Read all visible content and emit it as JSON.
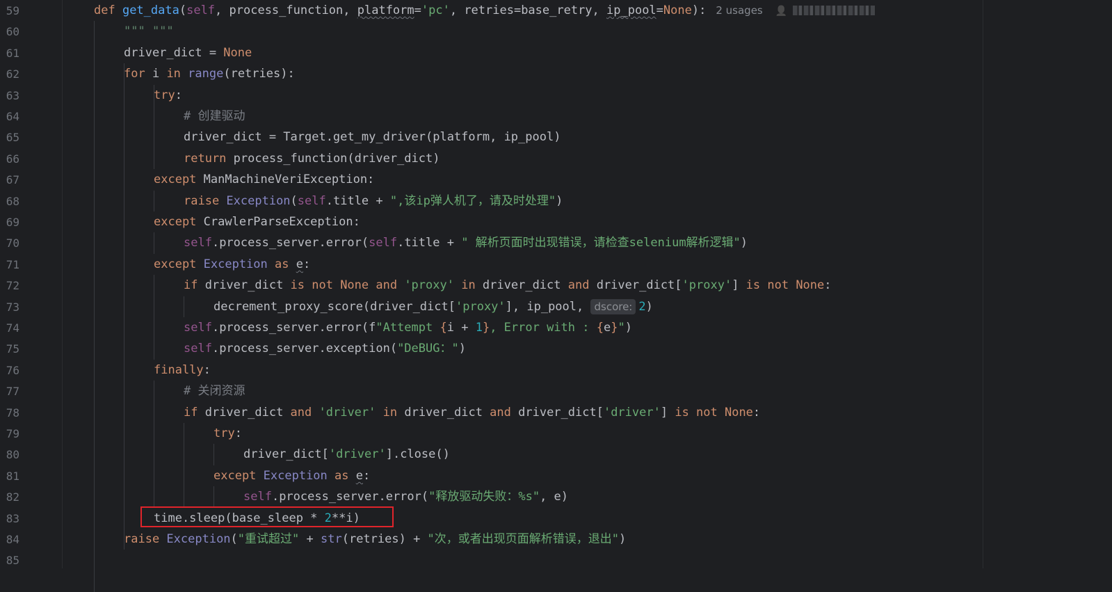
{
  "editor": {
    "lines": [
      {
        "n": "59",
        "t": [
          [
            "kw",
            "def "
          ],
          [
            "fn",
            "get_data"
          ],
          [
            "var",
            "("
          ],
          [
            "selfk",
            "self"
          ],
          [
            "var",
            ", process_function, "
          ],
          [
            "wavy",
            "platform"
          ],
          [
            "var",
            "="
          ],
          [
            "str",
            "'pc'"
          ],
          [
            "var",
            ", retries=base_retry, "
          ],
          [
            "wavy",
            "ip_pool"
          ],
          [
            "var",
            "="
          ],
          [
            "kw",
            "None"
          ],
          [
            "var",
            "):"
          ]
        ]
      },
      {
        "n": "60",
        "t": [
          [
            "doc",
            "\"\"\" \"\"\""
          ]
        ]
      },
      {
        "n": "61",
        "t": [
          [
            "var",
            "driver_dict = "
          ],
          [
            "kw",
            "None"
          ]
        ]
      },
      {
        "n": "62",
        "t": [
          [
            "kw",
            "for "
          ],
          [
            "var",
            "i "
          ],
          [
            "kw",
            "in "
          ],
          [
            "bi",
            "range"
          ],
          [
            "var",
            "(retries):"
          ]
        ]
      },
      {
        "n": "63",
        "t": [
          [
            "kw",
            "try"
          ],
          [
            "var",
            ":"
          ]
        ]
      },
      {
        "n": "64",
        "t": [
          [
            "cm",
            "# 创建驱动"
          ]
        ]
      },
      {
        "n": "65",
        "t": [
          [
            "var",
            "driver_dict = Target.get_my_driver(platform, ip_pool)"
          ]
        ]
      },
      {
        "n": "66",
        "t": [
          [
            "kw",
            "return "
          ],
          [
            "var",
            "process_function(driver_dict)"
          ]
        ]
      },
      {
        "n": "67",
        "t": [
          [
            "kw",
            "except "
          ],
          [
            "var",
            "ManMachineVeriException:"
          ]
        ]
      },
      {
        "n": "68",
        "t": [
          [
            "kw",
            "raise "
          ],
          [
            "bi",
            "Exception"
          ],
          [
            "var",
            "("
          ],
          [
            "selfk",
            "self"
          ],
          [
            "var",
            ".title + "
          ],
          [
            "str",
            "\",该ip弹人机了，请及时处理\""
          ],
          [
            "var",
            ")"
          ]
        ]
      },
      {
        "n": "69",
        "t": [
          [
            "kw",
            "except "
          ],
          [
            "var",
            "CrawlerParseException:"
          ]
        ]
      },
      {
        "n": "70",
        "t": [
          [
            "selfk",
            "self"
          ],
          [
            "var",
            ".process_server.error("
          ],
          [
            "selfk",
            "self"
          ],
          [
            "var",
            ".title + "
          ],
          [
            "str",
            "\" 解析页面时出现错误，请检查selenium解析逻辑\""
          ],
          [
            "var",
            ")"
          ]
        ]
      },
      {
        "n": "71",
        "t": [
          [
            "kw",
            "except "
          ],
          [
            "bi",
            "Exception "
          ],
          [
            "kw",
            "as "
          ],
          [
            "wavy",
            "e"
          ],
          [
            "var",
            ":"
          ]
        ]
      },
      {
        "n": "72",
        "t": [
          [
            "kw",
            "if "
          ],
          [
            "var",
            "driver_dict "
          ],
          [
            "kw",
            "is not None and "
          ],
          [
            "str",
            "'proxy' "
          ],
          [
            "kw",
            "in "
          ],
          [
            "var",
            "driver_dict "
          ],
          [
            "kw",
            "and "
          ],
          [
            "var",
            "driver_dict["
          ],
          [
            "str",
            "'proxy'"
          ],
          [
            "var",
            "] "
          ],
          [
            "kw",
            "is not None"
          ],
          [
            "var",
            ":"
          ]
        ]
      },
      {
        "n": "73",
        "t": [
          [
            "var",
            "decrement_proxy_score(driver_dict["
          ],
          [
            "str",
            "'proxy'"
          ],
          [
            "var",
            "], ip_pool, "
          ],
          [
            "hint",
            "dscore:"
          ],
          [
            "num",
            "2"
          ],
          [
            "var",
            ")"
          ]
        ]
      },
      {
        "n": "74",
        "t": [
          [
            "selfk",
            "self"
          ],
          [
            "var",
            ".process_server.error(f"
          ],
          [
            "str",
            "\"Attempt "
          ],
          [
            "kw",
            "{"
          ],
          [
            "var",
            "i + "
          ],
          [
            "num",
            "1"
          ],
          [
            "kw",
            "}"
          ],
          [
            "str",
            ", Error with : "
          ],
          [
            "kw",
            "{"
          ],
          [
            "var",
            "e"
          ],
          [
            "kw",
            "}"
          ],
          [
            "str",
            "\""
          ],
          [
            "var",
            ")"
          ]
        ]
      },
      {
        "n": "75",
        "t": [
          [
            "selfk",
            "self"
          ],
          [
            "var",
            ".process_server.exception("
          ],
          [
            "str",
            "\"DeBUG："
          ],
          [
            "str",
            "\""
          ],
          [
            "var",
            ")"
          ]
        ]
      },
      {
        "n": "76",
        "t": [
          [
            "kw",
            "finally"
          ],
          [
            "var",
            ":"
          ]
        ]
      },
      {
        "n": "77",
        "t": [
          [
            "cm",
            "# 关闭资源"
          ]
        ]
      },
      {
        "n": "78",
        "t": [
          [
            "kw",
            "if "
          ],
          [
            "var",
            "driver_dict "
          ],
          [
            "kw",
            "and "
          ],
          [
            "str",
            "'driver' "
          ],
          [
            "kw",
            "in "
          ],
          [
            "var",
            "driver_dict "
          ],
          [
            "kw",
            "and "
          ],
          [
            "var",
            "driver_dict["
          ],
          [
            "str",
            "'driver'"
          ],
          [
            "var",
            "] "
          ],
          [
            "kw",
            "is not None"
          ],
          [
            "var",
            ":"
          ]
        ]
      },
      {
        "n": "79",
        "t": [
          [
            "kw",
            "try"
          ],
          [
            "var",
            ":"
          ]
        ]
      },
      {
        "n": "80",
        "t": [
          [
            "var",
            "driver_dict["
          ],
          [
            "str",
            "'driver'"
          ],
          [
            "var",
            "].close()"
          ]
        ]
      },
      {
        "n": "81",
        "t": [
          [
            "kw",
            "except "
          ],
          [
            "bi",
            "Exception "
          ],
          [
            "kw",
            "as "
          ],
          [
            "wavy",
            "e"
          ],
          [
            "var",
            ":"
          ]
        ]
      },
      {
        "n": "82",
        "t": [
          [
            "selfk",
            "self"
          ],
          [
            "var",
            ".process_server.error("
          ],
          [
            "str",
            "\"释放驱动失败：%s\""
          ],
          [
            "var",
            ", e)"
          ]
        ]
      },
      {
        "n": "83",
        "t": [
          [
            "var",
            "time.sleep(base_sleep * "
          ],
          [
            "num",
            "2"
          ],
          [
            "var",
            "**i)"
          ]
        ]
      },
      {
        "n": "84",
        "t": [
          [
            "kw",
            "raise "
          ],
          [
            "bi",
            "Exception"
          ],
          [
            "var",
            "("
          ],
          [
            "str",
            "\"重试超过\""
          ],
          [
            "var",
            " + "
          ],
          [
            "bi",
            "str"
          ],
          [
            "var",
            "(retries) + "
          ],
          [
            "str",
            "\"次，或者出现页面解析错误，退出\""
          ],
          [
            "var",
            ")"
          ]
        ]
      },
      {
        "n": "85",
        "t": []
      }
    ],
    "usages_label": "2 usages",
    "author_icon": "person-icon",
    "highlight_color": "#e0242b"
  }
}
